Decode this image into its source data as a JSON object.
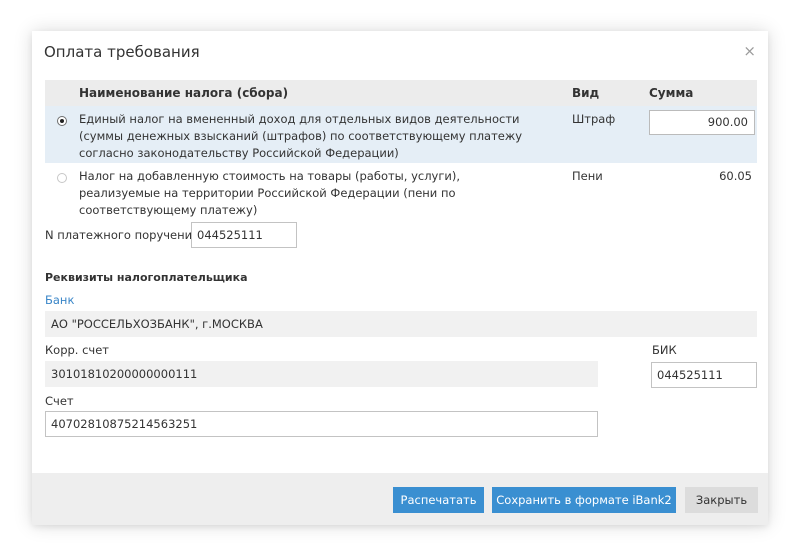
{
  "dialog": {
    "title": "Оплата требования",
    "close_glyph": "×"
  },
  "table": {
    "headers": {
      "name": "Наименование налога (сбора)",
      "kind": "Вид",
      "sum": "Сумма"
    },
    "rows": [
      {
        "selected": true,
        "name": "Единый налог на вмененный доход для отдельных видов деятельности (суммы денежных взысканий (штрафов) по соответствующему платежу согласно законодательству Российской Федерации)",
        "kind": "Штраф",
        "sum": "900.00"
      },
      {
        "selected": false,
        "name": "Налог на добавленную стоимость на товары (работы, услуги), реализуемые на территории Российской Федерации (пени по соответствующему платежу)",
        "kind": "Пени",
        "sum": "60.05"
      }
    ]
  },
  "payment_order": {
    "label": "N платежного поручения",
    "value": "044525111"
  },
  "taxpayer": {
    "section_title": "Реквизиты налогоплательщика",
    "bank_label": "Банк",
    "bank_value": "АО \"РОССЕЛЬХОЗБАНК\", г.МОСКВА",
    "corr_label": "Корр. счет",
    "corr_value": "30101810200000000111",
    "bik_label": "БИК",
    "bik_value": "044525111",
    "account_label": "Счет",
    "account_value": "40702810875214563251"
  },
  "footer": {
    "print_label": "Распечатать",
    "save_label": "Сохранить в формате iBank2",
    "close_label": "Закрыть"
  },
  "colors": {
    "primary_button": "#3a8fd1",
    "selected_row": "#e5eef6",
    "link": "#3a86c8"
  }
}
